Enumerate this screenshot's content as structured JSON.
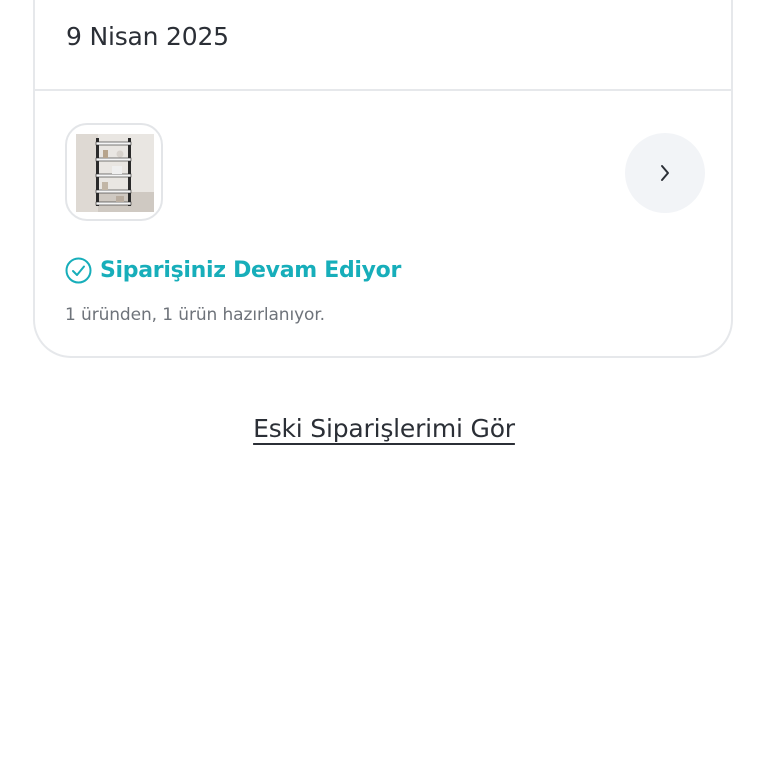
{
  "order": {
    "date": "9 Nisan 2025",
    "status": "Siparişiniz Devam Ediyor",
    "status_detail": "1 üründen, 1 ürün hazırlanıyor.",
    "status_color": "#17aeba",
    "product_image": "bookshelf-product-image",
    "detail_icon": "chevron-right-icon"
  },
  "links": {
    "old_orders": "Eski Siparişlerimi Gör"
  }
}
